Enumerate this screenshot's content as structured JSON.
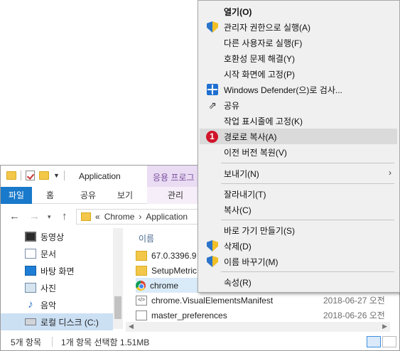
{
  "explorer": {
    "title": "Application",
    "contextual_tab_title": "응용 프로그",
    "ribbon_tabs": [
      "파일",
      "홈",
      "공유",
      "보기",
      "관리"
    ],
    "address": {
      "overflow": "«",
      "segments": [
        "Chrome",
        "Application"
      ]
    },
    "nav_items": [
      {
        "label": "동영상",
        "icon": "video-icon"
      },
      {
        "label": "문서",
        "icon": "document-icon"
      },
      {
        "label": "바탕 화면",
        "icon": "desktop-icon"
      },
      {
        "label": "사진",
        "icon": "pictures-icon"
      },
      {
        "label": "음악",
        "icon": "music-icon"
      },
      {
        "label": "로컬 디스크 (C:)",
        "icon": "disk-icon"
      }
    ],
    "column_header": "이름",
    "files": [
      {
        "name": "67.0.3396.9",
        "icon": "folder-icon",
        "date": ""
      },
      {
        "name": "SetupMetric",
        "icon": "folder-icon",
        "date": ""
      },
      {
        "name": "chrome",
        "icon": "chrome-icon",
        "date": ""
      },
      {
        "name": "chrome.VisualElementsManifest",
        "icon": "xml-icon",
        "date": "2018-06-27 오전"
      },
      {
        "name": "master_preferences",
        "icon": "file-icon",
        "date": "2018-06-26 오전"
      }
    ],
    "status": {
      "count": "5개 항목",
      "selection": "1개 항목 선택함 1.51MB"
    }
  },
  "context_menu": {
    "items": [
      {
        "label": "열기(O)",
        "bold": true,
        "icon": ""
      },
      {
        "label": "관리자 권한으로 실행(A)",
        "icon": "uac-shield-icon"
      },
      {
        "label": "다른 사용자로 실행(F)",
        "icon": ""
      },
      {
        "label": "호환성 문제 해결(Y)",
        "icon": ""
      },
      {
        "label": "시작 화면에 고정(P)",
        "icon": ""
      },
      {
        "label": "Windows Defender(으)로 검사...",
        "icon": "windows-defender-icon"
      },
      {
        "label": "공유",
        "icon": "share-icon"
      },
      {
        "label": "작업 표시줄에 고정(K)",
        "icon": ""
      },
      {
        "label": "경로로 복사(A)",
        "icon": "step-badge",
        "highlight": true,
        "badge": "1"
      },
      {
        "label": "이전 버전 복원(V)",
        "icon": ""
      },
      {
        "label": "보내기(N)",
        "icon": "",
        "submenu": true
      },
      {
        "label": "잘라내기(T)",
        "icon": ""
      },
      {
        "label": "복사(C)",
        "icon": ""
      },
      {
        "label": "바로 가기 만들기(S)",
        "icon": ""
      },
      {
        "label": "삭제(D)",
        "icon": "uac-shield-icon"
      },
      {
        "label": "이름 바꾸기(M)",
        "icon": "uac-shield-icon"
      },
      {
        "label": "속성(R)",
        "icon": ""
      }
    ]
  }
}
